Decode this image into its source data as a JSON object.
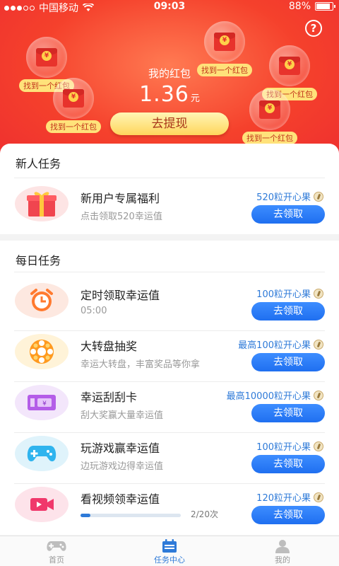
{
  "status_bar": {
    "carrier": "中国移动",
    "time": "09:03",
    "battery": "88%",
    "battery_level": 0.88
  },
  "header": {
    "wallet_title": "我的红包",
    "amount": "1.36",
    "amount_unit": "元",
    "withdraw_label": "去提现",
    "floating_packets": [
      {
        "label": "找到一个红包"
      },
      {
        "label": "找到一个红包"
      },
      {
        "label": "找到一个红包"
      },
      {
        "label": "找到一个红包"
      },
      {
        "label": "找到一个红包"
      },
      {
        "label": "找到一个红包"
      }
    ],
    "coin_symbol": "¥"
  },
  "new_user_section": {
    "title": "新人任务",
    "tasks": [
      {
        "name": "新用户专属福利",
        "desc": "点击领取520幸运值",
        "reward": "520粒开心果",
        "button": "去领取",
        "icon": "gift-icon"
      }
    ]
  },
  "daily_section": {
    "title": "每日任务",
    "tasks": [
      {
        "name": "定时领取幸运值",
        "desc": "05:00",
        "reward": "100粒开心果",
        "button": "去领取",
        "icon": "alarm-clock-icon"
      },
      {
        "name": "大转盘抽奖",
        "desc": "幸运大转盘，丰富奖品等你拿",
        "reward": "最高100粒开心果",
        "button": "去领取",
        "icon": "wheel-icon"
      },
      {
        "name": "幸运刮刮卡",
        "desc": "刮大奖赢大量幸运值",
        "reward": "最高10000粒开心果",
        "button": "去领取",
        "icon": "scratch-card-icon"
      },
      {
        "name": "玩游戏赢幸运值",
        "desc": "边玩游戏边得幸运值",
        "reward": "100粒开心果",
        "button": "去领取",
        "icon": "gamepad-icon"
      },
      {
        "name": "看视频领幸运值",
        "progress_text": "2/20次",
        "progress": 0.1,
        "reward": "120粒开心果",
        "button": "去领取",
        "icon": "video-icon"
      }
    ]
  },
  "tabbar": {
    "tabs": [
      {
        "label": "首页",
        "icon": "gamepad-tab-icon"
      },
      {
        "label": "任务中心",
        "icon": "calendar-tab-icon",
        "active": true
      },
      {
        "label": "我的",
        "icon": "person-tab-icon"
      }
    ]
  },
  "colors": {
    "primary": "#2e7ad8",
    "header_red": "#f5412c",
    "gold": "#ffd55c"
  }
}
